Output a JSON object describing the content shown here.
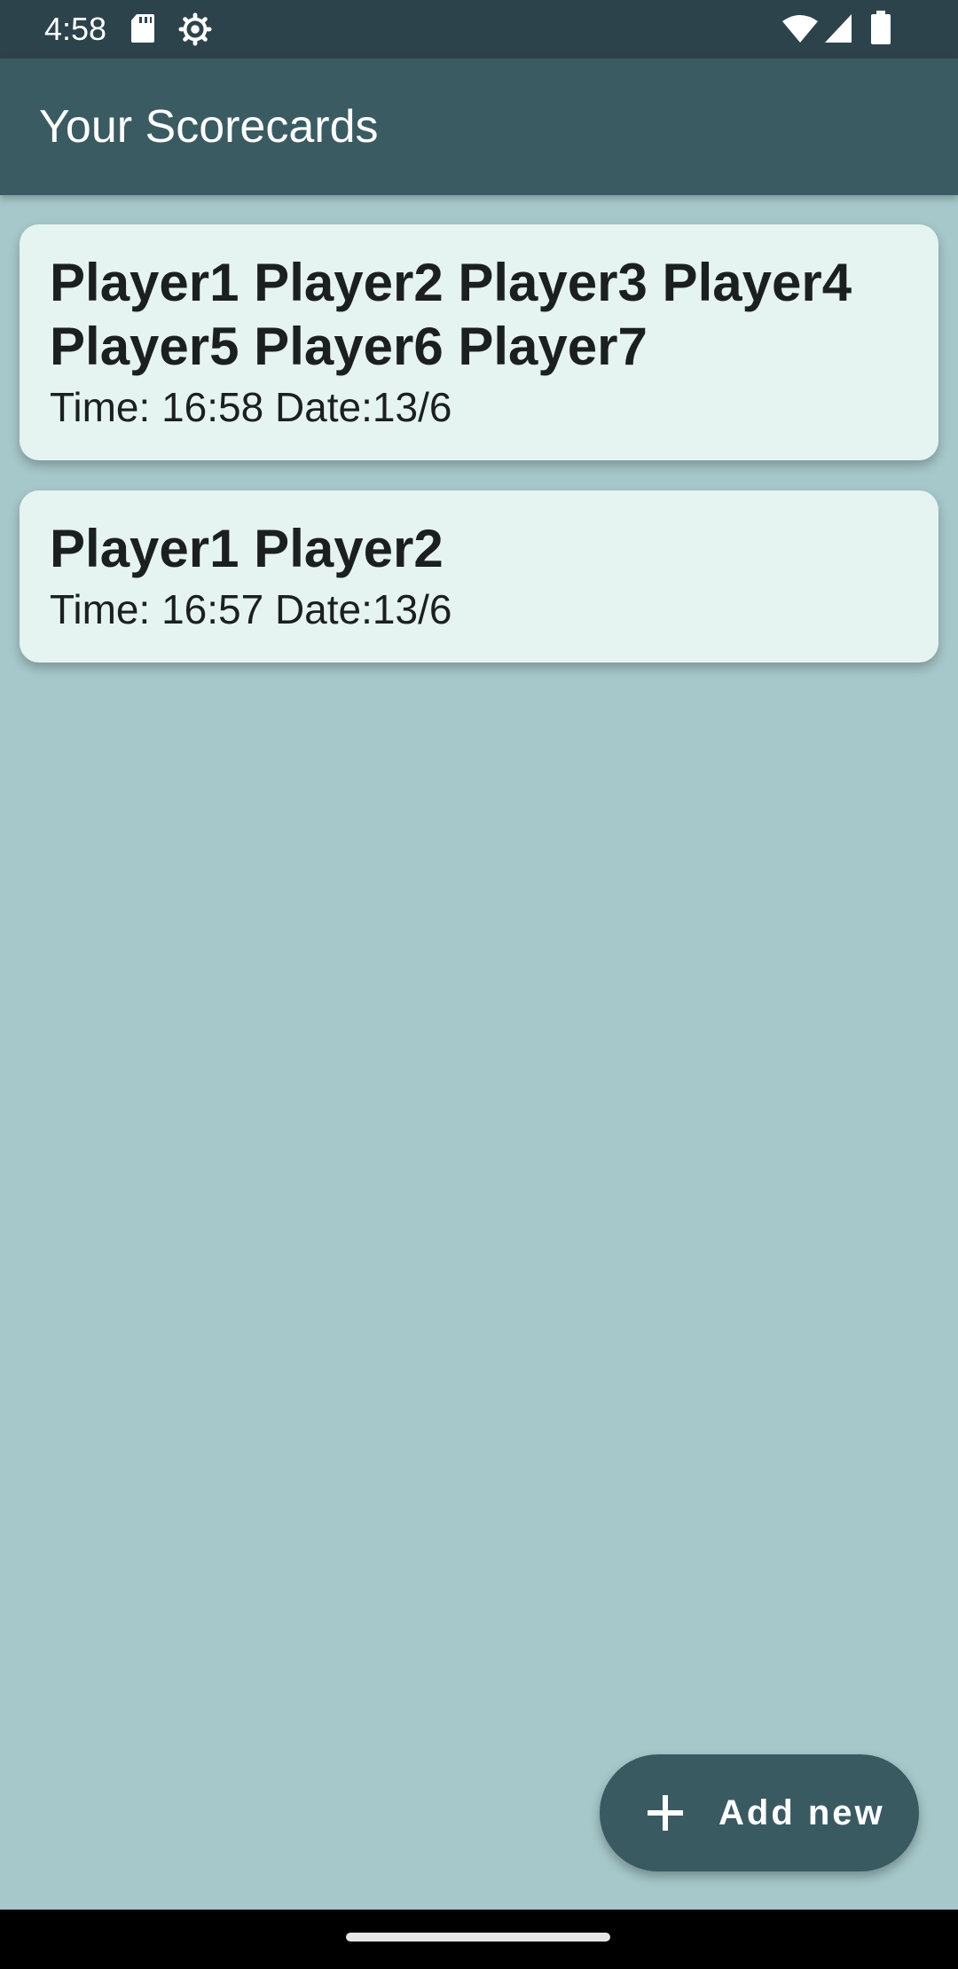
{
  "status_bar": {
    "time": "4:58",
    "icons": [
      "sd-card-icon",
      "settings-gear-icon",
      "wifi-icon",
      "signal-icon",
      "battery-icon"
    ]
  },
  "app_bar": {
    "title": "Your Scorecards"
  },
  "scorecards": [
    {
      "players": "Player1 Player2 Player3 Player4 Player5 Player6 Player7",
      "meta": "Time: 16:58 Date:13/6"
    },
    {
      "players": "Player1 Player2",
      "meta": "Time: 16:57 Date:13/6"
    }
  ],
  "fab": {
    "label": "Add new",
    "icon": "plus-icon"
  },
  "colors": {
    "background": "#a6c8ca",
    "app_bar": "#3b5b62",
    "status_bar": "#2d434c",
    "card": "#e5f3f1",
    "fab": "#3a5a62"
  }
}
